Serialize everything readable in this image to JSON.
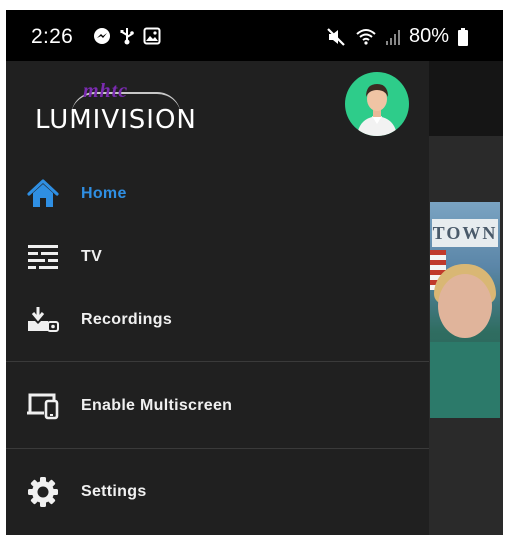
{
  "status_bar": {
    "time": "2:26",
    "battery": "80%",
    "left_icons": [
      "messenger-icon",
      "usb-icon",
      "gallery-icon"
    ],
    "right_icons": [
      "mute-icon",
      "wifi-icon",
      "signal-icon",
      "battery-icon"
    ]
  },
  "drawer": {
    "logo": {
      "top": "mhtc",
      "main": "LUMIVISION"
    },
    "items": [
      {
        "label": "Home",
        "icon": "home-icon",
        "active": true
      },
      {
        "label": "TV",
        "icon": "tv-guide-icon",
        "active": false
      },
      {
        "label": "Recordings",
        "icon": "recordings-download-icon",
        "active": false
      },
      {
        "label": "Enable Multiscreen",
        "icon": "multiscreen-devices-icon",
        "active": false
      },
      {
        "label": "Settings",
        "icon": "settings-gear-icon",
        "active": false
      }
    ]
  },
  "background": {
    "sign_text": "TOWN"
  },
  "colors": {
    "accent": "#2f8fe3",
    "drawer_bg": "#202020",
    "avatar_bg": "#2ecc8a",
    "brand": "#7a2bb0"
  }
}
